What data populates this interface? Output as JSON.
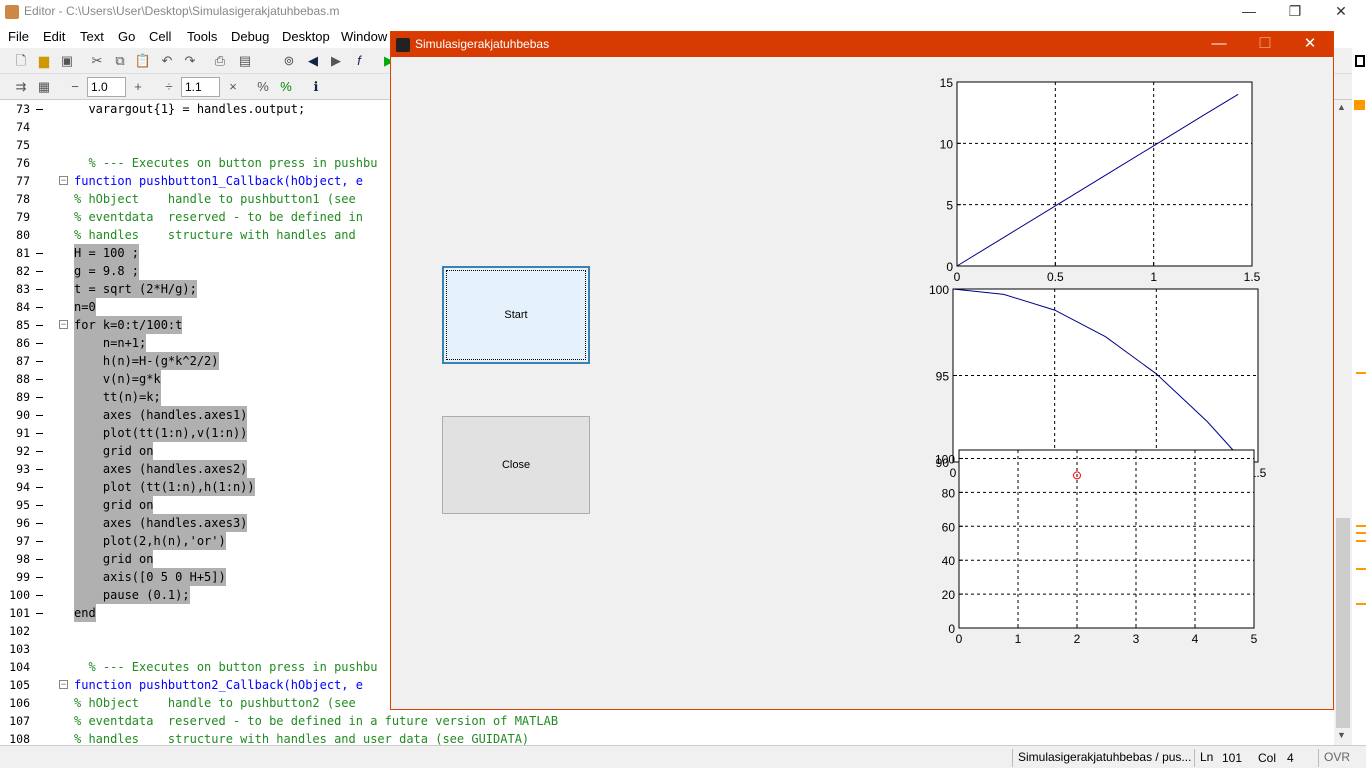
{
  "editor": {
    "title": "Editor - C:\\Users\\User\\Desktop\\Simulasigerakjatuhbebas.m",
    "menu": [
      "File",
      "Edit",
      "Text",
      "Go",
      "Cell",
      "Tools",
      "Debug",
      "Desktop",
      "Window"
    ],
    "zoom_a": "1.0",
    "zoom_b": "1.1",
    "lines": [
      {
        "n": "73",
        "dash": true,
        "text": "  varargout{1} = handles.output;",
        "type": "code"
      },
      {
        "n": "74",
        "dash": false,
        "text": "",
        "type": "code"
      },
      {
        "n": "75",
        "dash": false,
        "text": "",
        "type": "code"
      },
      {
        "n": "76",
        "dash": false,
        "text": "  % --- Executes on button press in pushbu",
        "type": "comment"
      },
      {
        "n": "77",
        "dash": false,
        "text": "function pushbutton1_Callback(hObject, e",
        "type": "func"
      },
      {
        "n": "78",
        "dash": false,
        "text": "% hObject    handle to pushbutton1 (see",
        "type": "comment"
      },
      {
        "n": "79",
        "dash": false,
        "text": "% eventdata  reserved - to be defined in",
        "type": "comment"
      },
      {
        "n": "80",
        "dash": false,
        "text": "% handles    structure with handles and",
        "type": "comment"
      },
      {
        "n": "81",
        "dash": true,
        "text": "H = 100 ;",
        "type": "sel"
      },
      {
        "n": "82",
        "dash": true,
        "text": "g = 9.8 ;",
        "type": "sel"
      },
      {
        "n": "83",
        "dash": true,
        "text": "t = sqrt (2*H/g);",
        "type": "sel"
      },
      {
        "n": "84",
        "dash": true,
        "text": "n=0",
        "type": "sel"
      },
      {
        "n": "85",
        "dash": true,
        "text": "for k=0:t/100:t",
        "type": "selfor"
      },
      {
        "n": "86",
        "dash": true,
        "text": "    n=n+1;",
        "type": "sel"
      },
      {
        "n": "87",
        "dash": true,
        "text": "    h(n)=H-(g*k^2/2)",
        "type": "sel"
      },
      {
        "n": "88",
        "dash": true,
        "text": "    v(n)=g*k",
        "type": "sel"
      },
      {
        "n": "89",
        "dash": true,
        "text": "    tt(n)=k;",
        "type": "sel"
      },
      {
        "n": "90",
        "dash": true,
        "text": "    axes (handles.axes1)",
        "type": "sel"
      },
      {
        "n": "91",
        "dash": true,
        "text": "    plot(tt(1:n),v(1:n))",
        "type": "sel"
      },
      {
        "n": "92",
        "dash": true,
        "text": "    grid on",
        "type": "sel"
      },
      {
        "n": "93",
        "dash": true,
        "text": "    axes (handles.axes2)",
        "type": "sel"
      },
      {
        "n": "94",
        "dash": true,
        "text": "    plot (tt(1:n),h(1:n))",
        "type": "sel"
      },
      {
        "n": "95",
        "dash": true,
        "text": "    grid on",
        "type": "sel"
      },
      {
        "n": "96",
        "dash": true,
        "text": "    axes (handles.axes3)",
        "type": "sel"
      },
      {
        "n": "97",
        "dash": true,
        "text": "    plot(2,h(n),'or')",
        "type": "sel"
      },
      {
        "n": "98",
        "dash": true,
        "text": "    grid on",
        "type": "sel"
      },
      {
        "n": "99",
        "dash": true,
        "text": "    axis([0 5 0 H+5])",
        "type": "sel"
      },
      {
        "n": "100",
        "dash": true,
        "text": "    pause (0.1);",
        "type": "sel"
      },
      {
        "n": "101",
        "dash": true,
        "text": "end",
        "type": "selend"
      },
      {
        "n": "102",
        "dash": false,
        "text": "",
        "type": "code"
      },
      {
        "n": "103",
        "dash": false,
        "text": "",
        "type": "code"
      },
      {
        "n": "104",
        "dash": false,
        "text": "  % --- Executes on button press in pushbu",
        "type": "comment"
      },
      {
        "n": "105",
        "dash": false,
        "text": "function pushbutton2_Callback(hObject, e",
        "type": "func"
      },
      {
        "n": "106",
        "dash": false,
        "text": "% hObject    handle to pushbutton2 (see",
        "type": "comment"
      },
      {
        "n": "107",
        "dash": false,
        "text": "% eventdata  reserved - to be defined in a future version of MATLAB",
        "type": "comment"
      },
      {
        "n": "108",
        "dash": false,
        "text": "% handles    structure with handles and user data (see GUIDATA)",
        "type": "comment"
      }
    ],
    "status": {
      "file": "Simulasigerakjatuhbebas / pus...",
      "ln_label": "Ln",
      "ln": "101",
      "col_label": "Col",
      "col": "4",
      "ovr": "OVR"
    }
  },
  "figure": {
    "title": "Simulasigerakjatuhbebas",
    "start_label": "Start",
    "close_label": "Close"
  },
  "chart_data": [
    {
      "type": "line",
      "x": [
        0,
        0.25,
        0.5,
        0.75,
        1.0,
        1.25,
        1.43
      ],
      "y": [
        0,
        2.45,
        4.9,
        7.35,
        9.8,
        12.25,
        14.0
      ],
      "xlim": [
        0,
        1.5
      ],
      "ylim": [
        0,
        15
      ],
      "xticks": [
        "0",
        "0.5",
        "1",
        "1.5"
      ],
      "yticks": [
        "0",
        "5",
        "10",
        "15"
      ],
      "grid": true,
      "color": "#00008b"
    },
    {
      "type": "line",
      "x": [
        0,
        0.25,
        0.5,
        0.75,
        1.0,
        1.25,
        1.43
      ],
      "y": [
        100,
        99.69,
        98.78,
        97.24,
        95.1,
        92.34,
        90.0
      ],
      "xlim": [
        0,
        1.5
      ],
      "ylim": [
        90,
        100
      ],
      "xticks": [
        "0",
        "0.5",
        "1",
        "1.5"
      ],
      "yticks": [
        "90",
        "95",
        "100"
      ],
      "grid": true,
      "color": "#00008b"
    },
    {
      "type": "scatter",
      "x": [
        2
      ],
      "y": [
        90
      ],
      "xlim": [
        0,
        5
      ],
      "ylim": [
        0,
        105
      ],
      "xticks": [
        "0",
        "1",
        "2",
        "3",
        "4",
        "5"
      ],
      "yticks": [
        "0",
        "20",
        "40",
        "60",
        "80",
        "100"
      ],
      "grid": true,
      "color": "#ff0000"
    }
  ]
}
